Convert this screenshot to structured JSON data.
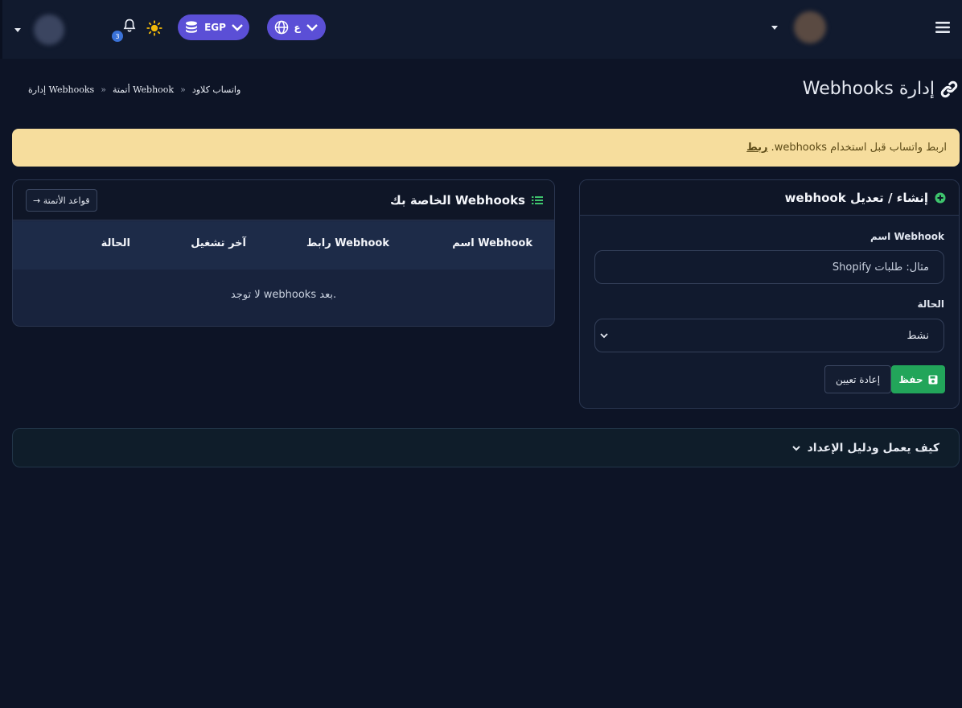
{
  "topbar": {
    "user_name_left": "",
    "notification_count": "3",
    "currency": "EGP",
    "language": "ع",
    "user_name_right": ""
  },
  "page": {
    "title": "إدارة Webhooks",
    "breadcrumb": [
      "واتساب كلاود",
      "أتمتة Webhook",
      "إدارة Webhooks"
    ]
  },
  "alert": {
    "text": "اربط واتساب قبل استخدام webhooks.",
    "link": "ربط"
  },
  "form_card": {
    "title": "إنشاء / تعديل webhook",
    "name_label": "اسم Webhook",
    "name_placeholder": "مثال: طلبات Shopify",
    "status_label": "الحالة",
    "status_value": "نشط",
    "save_label": "حفظ",
    "reset_label": "إعادة تعيين"
  },
  "list_card": {
    "title": "Webhooks الخاصة بك",
    "rules_button": "قواعد الأتمتة →",
    "columns": [
      "اسم Webhook",
      "رابط Webhook",
      "آخر تشغيل",
      "الحالة"
    ],
    "empty_text": "لا توجد webhooks بعد."
  },
  "accordion": {
    "title": "كيف يعمل ودليل الإعداد"
  },
  "colors": {
    "background": "#0d1426",
    "accent": "#5b4fd6",
    "alert_bg": "#f6dd9d",
    "save_button": "#22a55a"
  }
}
